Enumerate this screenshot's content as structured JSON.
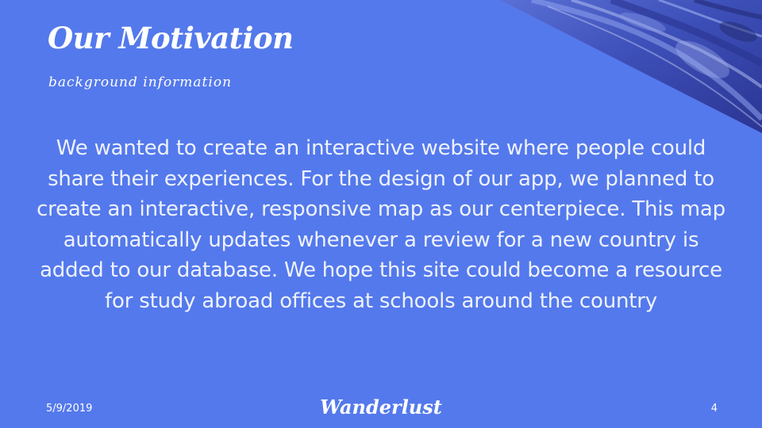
{
  "slide": {
    "title": "Our Motivation",
    "subtitle": "background information",
    "body": "We wanted to create an interactive website where people could share their experiences. For the design of our app, we planned to create an interactive, responsive map as our centerpiece. This map automatically updates whenever a review for a new country is added to our database. We hope this site could become a resource for study abroad offices at schools around the country",
    "background_color": "#5479ec",
    "corner_image": "canyon-rock-photo"
  },
  "footer": {
    "date": "5/9/2019",
    "brand": "Wanderlust",
    "page_number": "4"
  }
}
